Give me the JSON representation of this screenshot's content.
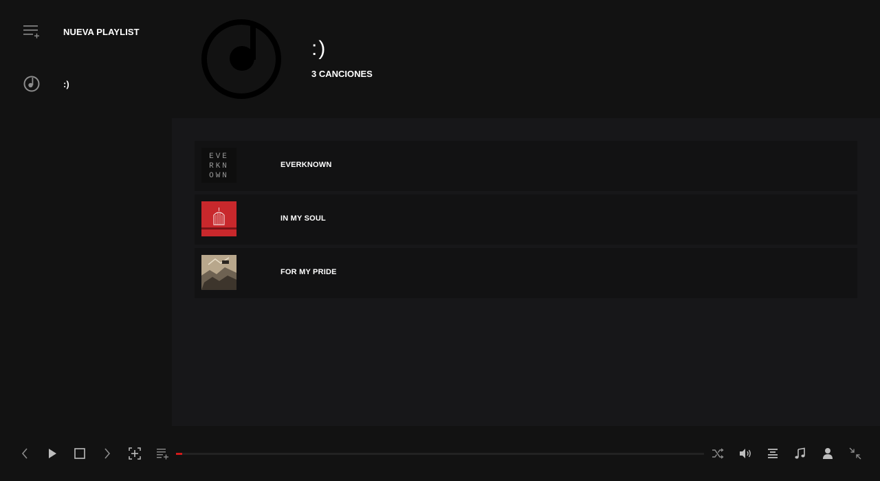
{
  "sidebar": {
    "new_playlist_label": "NUEVA PLAYLIST",
    "playlists": [
      {
        "label": ":)"
      }
    ]
  },
  "header": {
    "title": ":)",
    "count": "3 CANCIONES"
  },
  "songs": [
    {
      "title": "EVERKNOWN",
      "cover_text": [
        "EVE",
        "RKN",
        "OWN"
      ],
      "cover_bg": "#111111"
    },
    {
      "title": "IN MY SOUL",
      "cover_bg": "#c8282c"
    },
    {
      "title": "FOR MY PRIDE",
      "cover_bg": "#b8a78c"
    }
  ],
  "player": {
    "progress_fraction": 0.012,
    "accent_color": "#d21a1a",
    "controls": [
      "previous-icon",
      "play-icon",
      "stop-icon",
      "next-icon",
      "add-to-focus-icon",
      "add-to-playlist-icon",
      "shuffle-icon",
      "volume-icon",
      "queue-icon",
      "music-note-icon",
      "user-icon",
      "minimize-icon"
    ]
  }
}
